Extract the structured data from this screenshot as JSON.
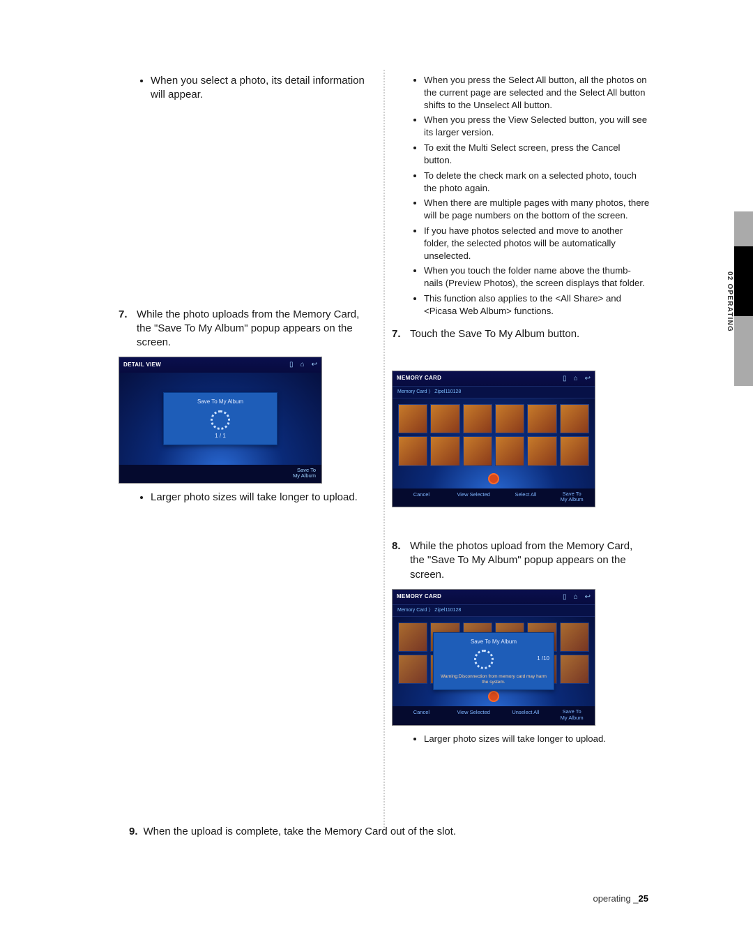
{
  "side_tab": "02 OPERATING",
  "left": {
    "bullet1": "When you select a photo, its detail information will appear.",
    "step7": "While the photo uploads from the Memory Card, the \"Save To My Album\" popup appears on the screen.",
    "fig7": {
      "title": "DETAIL VIEW",
      "popup": "Save To My Album",
      "progress": "1 / 1",
      "save_btn_line1": "Save To",
      "save_btn_line2": "My Album"
    },
    "bullet2": "Larger photo sizes will take longer to upload."
  },
  "right": {
    "bullets": [
      "When you press the Select All button, all the photos on the current page are selected and the Select All button shifts to the Unselect All button.",
      "When you press the View Selected button, you will see its larger version.",
      "To exit the Multi Select screen, press the Cancel button.",
      "To delete the check mark on a selected photo, touch the photo again.",
      "When there are multiple pages with many photos, there will be page numbers on the bottom of the screen.",
      "If you have photos selected and move to another folder, the selected photos will be automatically unselected.",
      "When you touch the folder name above the thumb-nails (Preview Photos), the screen displays that folder.",
      "This function also applies to the <All Share> and <Picasa Web Album> functions."
    ],
    "step7": "Touch the Save To My Album button.",
    "figA": {
      "title": "MEMORY CARD",
      "crumb": "Memory Card 〉 Zipel110128",
      "btn_cancel": "Cancel",
      "btn_view": "View Selected",
      "btn_select": "Select All",
      "save_btn_line1": "Save To",
      "save_btn_line2": "My Album"
    },
    "step8": "While the photos upload from the Memory Card, the \"Save To My Album\" popup appears on the screen.",
    "figB": {
      "title": "MEMORY CARD",
      "crumb": "Memory Card 〉 Zipel110128",
      "popup": "Save To My Album",
      "progress": "1 /10",
      "warning": "Warning:Disconnection from memory card may harm the system.",
      "btn_cancel": "Cancel",
      "btn_view": "View Selected",
      "btn_unselect": "Unselect All",
      "save_btn_line1": "Save To",
      "save_btn_line2": "My Album"
    },
    "bullet_last": "Larger photo sizes will take longer to upload."
  },
  "num": {
    "n7": "7.",
    "n8": "8.",
    "n9": "9."
  },
  "step9": "When the upload is complete, take the Memory Card out of the slot.",
  "footer": {
    "label": "operating _",
    "page": "25"
  }
}
